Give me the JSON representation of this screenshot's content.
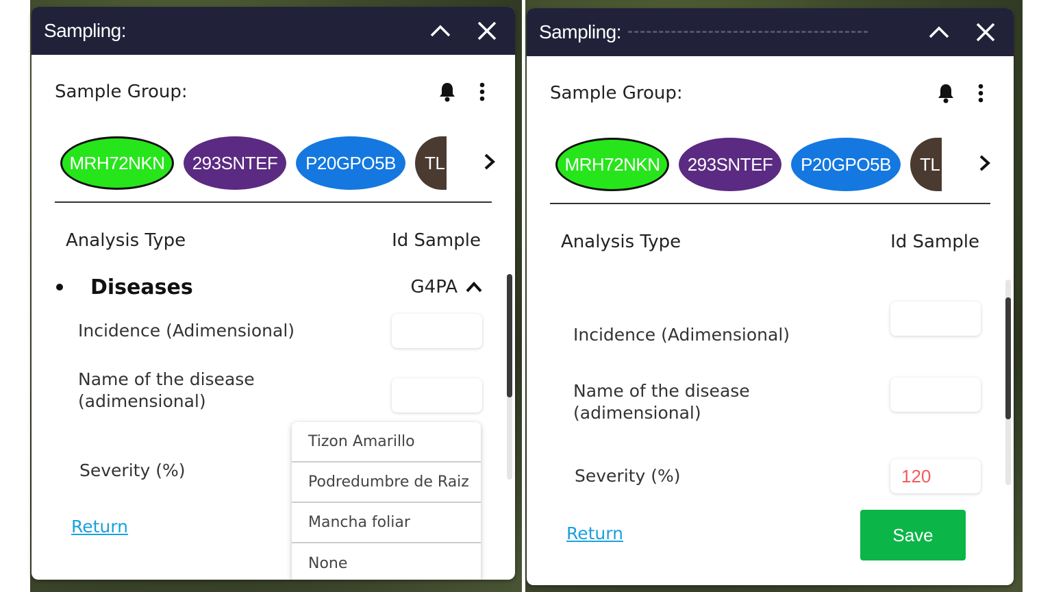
{
  "left": {
    "title": "Sampling:",
    "group_label": "Sample Group:",
    "chips": [
      "MRH72NKN",
      "293SNTEF",
      "P20GPO5B",
      "TL"
    ],
    "headers": {
      "analysis": "Analysis Type",
      "id": "Id Sample"
    },
    "section": {
      "title": "Diseases",
      "id": "G4PA"
    },
    "fields": {
      "incidence": "Incidence (Adimensional)",
      "disease_line1": "Name of the disease",
      "disease_line2": "(adimensional)",
      "severity": "Severity (%)"
    },
    "return_label": "Return",
    "dropdown_options": [
      "Tizon Amarillo",
      "Podredumbre de Raiz",
      "Mancha foliar",
      "None"
    ]
  },
  "right": {
    "title": "Sampling:",
    "group_label": "Sample Group:",
    "chips": [
      "MRH72NKN",
      "293SNTEF",
      "P20GPO5B",
      "TL"
    ],
    "headers": {
      "analysis": "Analysis Type",
      "id": "Id Sample"
    },
    "fields": {
      "incidence": "Incidence (Adimensional)",
      "disease_line1": "Name of the disease",
      "disease_line2": "(adimensional)",
      "severity": "Severity (%)"
    },
    "severity_value": "120",
    "return_label": "Return",
    "save_label": "Save"
  },
  "icons": {
    "collapse": "chevron-up-icon",
    "close": "close-icon",
    "notifications": "bell-icon",
    "more": "more-vertical-icon",
    "next": "chevron-right-icon",
    "section_toggle": "chevron-up-icon"
  },
  "colors": {
    "titlebar": "#22213a",
    "chip_green": "#27e51b",
    "chip_purple": "#5b2a82",
    "chip_blue": "#1478e0",
    "chip_brown": "#4a3a30",
    "save": "#0bb548",
    "link": "#1aa0dd",
    "invalid_value": "#f25b5b"
  }
}
